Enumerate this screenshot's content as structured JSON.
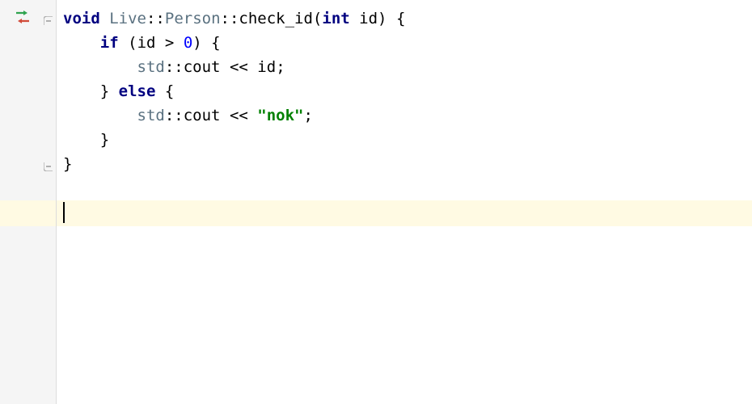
{
  "code": {
    "line1": {
      "kw_void": "void",
      "ns": "Live",
      "sep1": "::",
      "cls": "Person",
      "sep2": "::",
      "fn": "check_id",
      "paren_open": "(",
      "kw_int": "int",
      "param": "id",
      "paren_close": ")",
      "brace_open": "{"
    },
    "line2": {
      "kw_if": "if",
      "paren_open": "(",
      "ident": "id",
      "op": ">",
      "num": "0",
      "paren_close": ")",
      "brace_open": "{"
    },
    "line3": {
      "std": "std",
      "sep": "::",
      "cout": "cout",
      "op": "<<",
      "ident": "id",
      "semi": ";"
    },
    "line4": {
      "brace_close": "}",
      "kw_else": "else",
      "brace_open": "{"
    },
    "line5": {
      "std": "std",
      "sep": "::",
      "cout": "cout",
      "op": "<<",
      "str": "\"nok\"",
      "semi": ";"
    },
    "line6": {
      "brace_close": "}"
    },
    "line7": {
      "brace_close": "}"
    }
  },
  "icons": {
    "vcs": "vcs-change-icon",
    "fold_open": "fold-open-icon",
    "fold_close": "fold-close-icon"
  }
}
